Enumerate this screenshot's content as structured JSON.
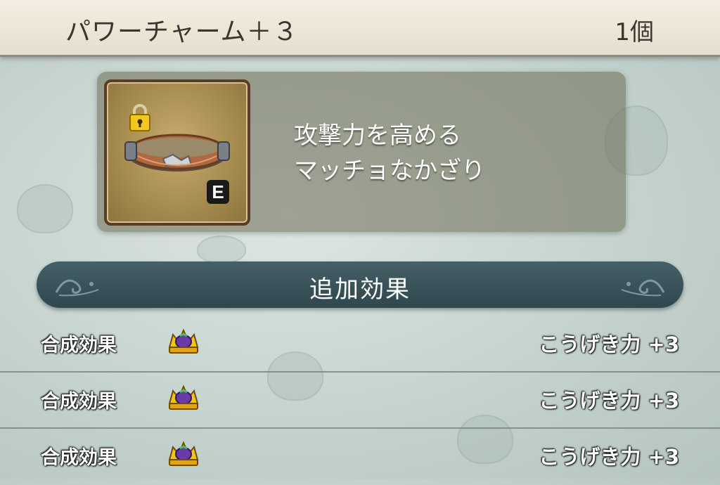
{
  "header": {
    "title": "パワーチャーム＋３",
    "count": "1個"
  },
  "item": {
    "icon": "belt-icon",
    "locked": true,
    "equipped_badge": "E",
    "description_lines": [
      "攻撃力を高める",
      "マッチョなかざり"
    ]
  },
  "section": {
    "title": "追加効果"
  },
  "effects": [
    {
      "name": "合成効果",
      "icon": "crown-icon",
      "value": "こうげき力 +3"
    },
    {
      "name": "合成効果",
      "icon": "crown-icon",
      "value": "こうげき力 +3"
    },
    {
      "name": "合成効果",
      "icon": "crown-icon",
      "value": "こうげき力 +3"
    }
  ]
}
